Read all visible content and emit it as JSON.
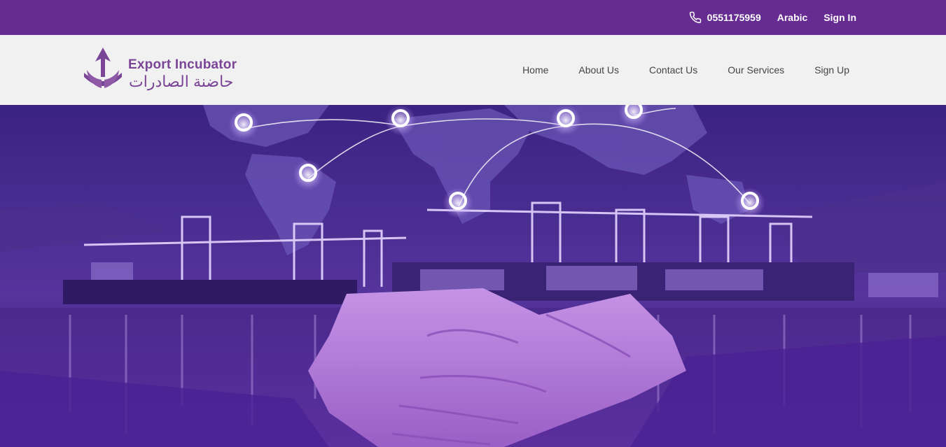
{
  "topbar": {
    "phone": "0551175959",
    "language": "Arabic",
    "signin": "Sign In"
  },
  "brand": {
    "name_en": "Export Incubator",
    "name_ar": "حاضنة الصادرات"
  },
  "nav": {
    "items": [
      "Home",
      "About Us",
      "Contact Us",
      "Our Services",
      "Sign Up"
    ]
  },
  "colors": {
    "primary": "#662c91",
    "nav_bg": "#f1f1f1"
  },
  "icons": {
    "phone": "phone-icon"
  }
}
